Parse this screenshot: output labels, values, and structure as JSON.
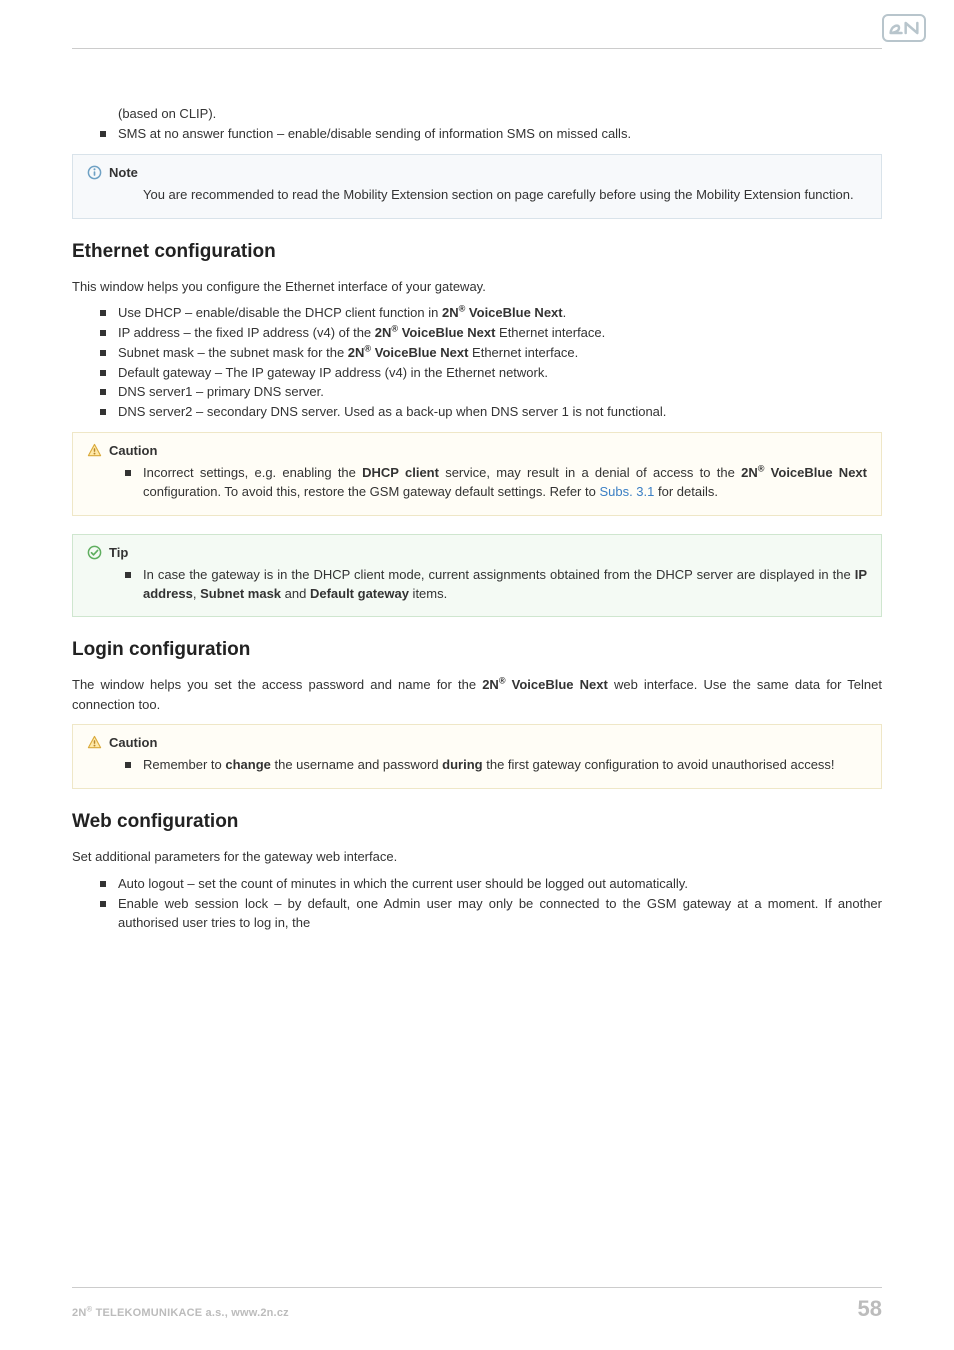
{
  "intro": {
    "li1": "(based on CLIP).",
    "li2": "SMS at no answer function – enable/disable sending of information SMS on missed calls."
  },
  "note1": {
    "title": "Note",
    "li1": "You are recommended to read the Mobility Extension section on page carefully before using the Mobility Extension function."
  },
  "ethernet": {
    "heading": "Ethernet configuration",
    "para": "This window helps you configure the Ethernet interface of your gateway.",
    "li1_pre": "Use DHCP – enable/disable the DHCP client function in ",
    "li1_brand": "2N",
    "li1_post": " VoiceBlue Next",
    "li1_end": ".",
    "li2_pre": "IP address – the fixed IP address (v4) of the ",
    "li2_brand": "2N",
    "li2_post": " VoiceBlue Next",
    "li2_end": " Ethernet interface.",
    "li3_pre": "Subnet mask – the subnet mask for the ",
    "li3_brand": "2N",
    "li3_post": " VoiceBlue Next",
    "li3_end": " Ethernet interface.",
    "li4": "Default gateway – The IP gateway IP address (v4) in the Ethernet network.",
    "li5": "DNS server1 – primary DNS server.",
    "li6": "DNS server2 – secondary DNS server. Used as a back-up when DNS server 1 is not functional."
  },
  "caution1": {
    "title": "Caution",
    "li_pre": "Incorrect settings, e.g. enabling the ",
    "li_b1": "DHCP client",
    "li_mid1": " service, may result in a denial of access to the ",
    "li_brand": "2N",
    "li_b2": " VoiceBlue Next",
    "li_mid2": " configuration. To avoid this, restore the GSM gateway default settings. Refer to ",
    "li_link": "Subs. 3.1",
    "li_end": " for details."
  },
  "tip1": {
    "title": "Tip",
    "li_pre": "In case the gateway is in the DHCP client mode, current assignments obtained from the DHCP server are displayed in the ",
    "li_b1": "IP address",
    "li_sep1": ", ",
    "li_b2": "Subnet mask",
    "li_sep2": " and ",
    "li_b3": "Default gateway",
    "li_end": " items."
  },
  "login": {
    "heading": "Login configuration",
    "para_pre": "The window helps you set the access password and name for the ",
    "para_brand": "2N",
    "para_b": " VoiceBlue Next",
    "para_end": " web interface. Use the same data for Telnet connection too."
  },
  "caution2": {
    "title": "Caution",
    "li_pre": "Remember to ",
    "li_b1": "change",
    "li_mid": " the username and password ",
    "li_b2": "during",
    "li_end": " the first gateway configuration to avoid unauthorised access!"
  },
  "web": {
    "heading": "Web configuration",
    "para": "Set additional parameters for the gateway web interface.",
    "li1": "Auto logout – set the count of minutes in which the current user should be logged out automatically.",
    "li2": "Enable web session lock – by default, one Admin user may only be connected to the GSM gateway at a moment. If another authorised user tries to log in, the"
  },
  "footer": {
    "left_pre": "2N",
    "left_post": " TELEKOMUNIKACE a.s., www.2n.cz",
    "page": "58"
  }
}
